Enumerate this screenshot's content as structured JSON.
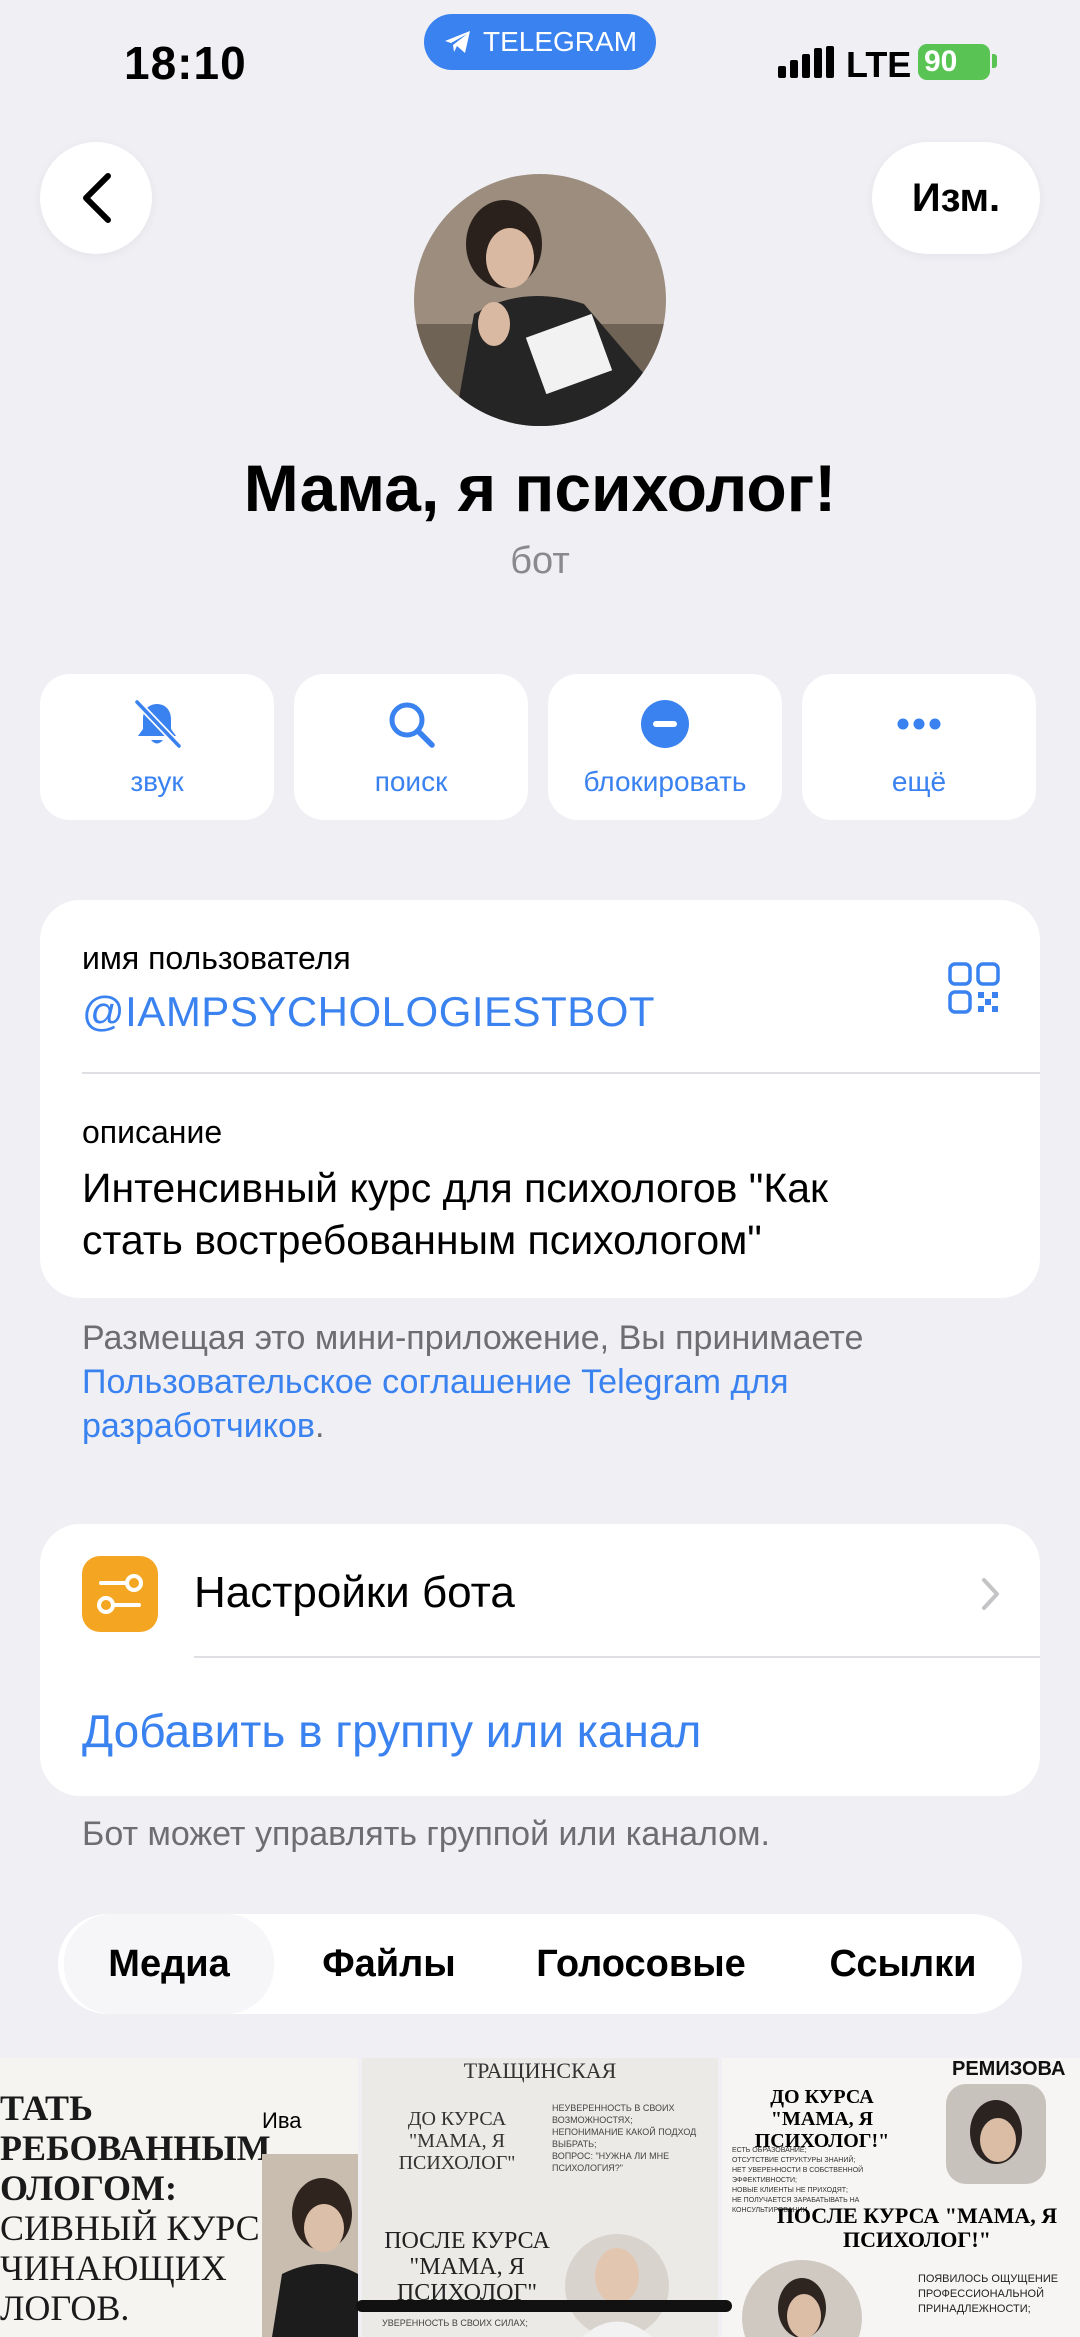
{
  "status_bar": {
    "time": "18:10",
    "app_pill": "TELEGRAM",
    "network": "LTE",
    "battery": "90"
  },
  "header": {
    "edit_label": "Изм."
  },
  "profile": {
    "name": "Мама, я психолог!",
    "subtitle": "бот"
  },
  "actions": [
    {
      "label": "звук",
      "icon": "bell-slash-icon"
    },
    {
      "label": "поиск",
      "icon": "search-icon"
    },
    {
      "label": "блокировать",
      "icon": "block-icon"
    },
    {
      "label": "ещё",
      "icon": "more-icon"
    }
  ],
  "info": {
    "username_label": "имя пользователя",
    "username": "@IAMPSYCHOLOGIESTBOT",
    "description_label": "описание",
    "description_line1": "Интенсивный курс для психологов \"Как",
    "description_line2": "стать востребованным психологом\""
  },
  "terms": {
    "line1": "Размещая это мини-приложение, Вы принимаете",
    "link_line1": "Пользовательское соглашение Telegram для",
    "link_line2": "разработчиков",
    "suffix": "."
  },
  "settings": {
    "bot_settings": "Настройки бота",
    "add_to_group": "Добавить в группу или канал",
    "note": "Бот может управлять группой или каналом."
  },
  "tabs": [
    "Медиа",
    "Файлы",
    "Голосовые",
    "Ссылки"
  ],
  "media": [
    {
      "lines": [
        "ТАТЬ",
        "РЕБОВАННЫМ",
        "ОЛОГОМ:",
        "СИВНЫЙ КУРС",
        "ЧИНАЮЩИХ",
        "ЛОГОВ."
      ],
      "side": "Ива"
    },
    {
      "top": "ТРАЩИНСКАЯ",
      "before": "ДО КУРСА \"МАМА, Я ПСИХОЛОГ\"",
      "after": "ПОСЛЕ КУРСА \"МАМА, Я ПСИХОЛОГ\"",
      "bullets": [
        "НЕУВЕРЕННОСТЬ В СВОИХ ВОЗМОЖНОСТЯХ;",
        "НЕПОНИМАНИЕ КАКОЙ ПОДХОД ВЫБРАТЬ;",
        "ВОПРОС: \"НУЖНА ЛИ МНЕ ПСИХОЛОГИЯ?\""
      ],
      "bottom": "УВЕРЕННОСТЬ В СВОИХ СИЛАХ;"
    },
    {
      "top": "РЕМИЗОВА",
      "before": "ДО КУРСА \"МАМА, Я ПСИХОЛОГ!\"",
      "after": "ПОСЛЕ КУРСА \"МАМА, Я ПСИХОЛОГ!\"",
      "bullets": [
        "ЕСТЬ ОБРАЗОВАНИЕ;",
        "ОТСУТСТВИЕ СТРУКТУРЫ ЗНАНИЙ;",
        "НЕТ УВЕРЕННОСТИ В СОБСТВЕННОЙ ЭФФЕКТИВНОСТИ;",
        "НОВЫЕ КЛИЕНТЫ НЕ ПРИХОДЯТ;",
        "НЕ ПОЛУЧАЕТСЯ ЗАРАБАТЫВАТЬ НА КОНСУЛЬТИРОВАНИИ."
      ],
      "after_bullets": [
        "ПОЯВИЛОСЬ ОЩУЩЕНИЕ",
        "ПРОФЕССИОНАЛЬНОЙ",
        "ПРИНАДЛЕЖНОСТИ;"
      ]
    }
  ],
  "colors": {
    "accent": "#3a82f0",
    "background": "#efeff4",
    "battery": "#59c453",
    "settings_icon": "#f4a623"
  }
}
